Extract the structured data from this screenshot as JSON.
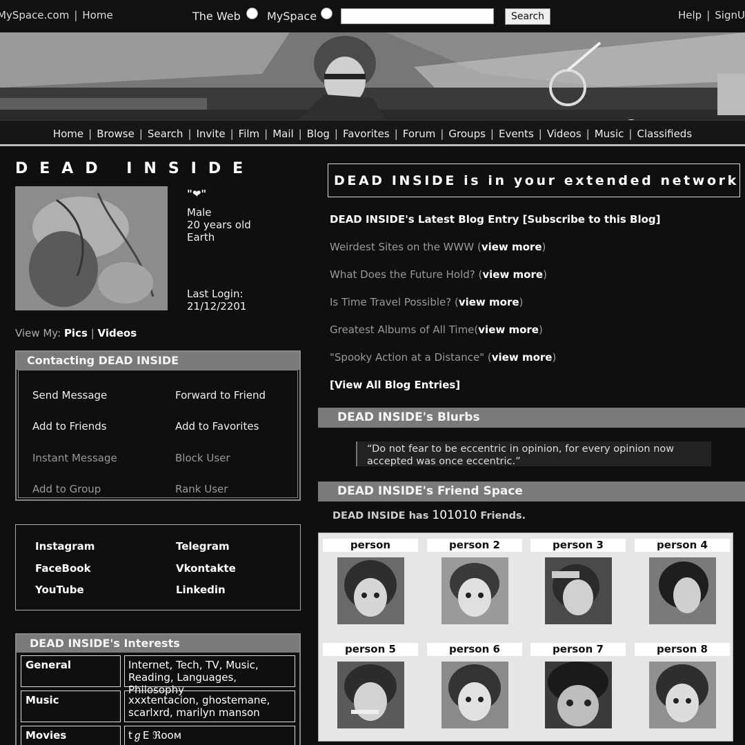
{
  "topbar": {
    "site": "MySpace.com",
    "home": "Home",
    "radio_web": "The Web",
    "radio_myspace": "MySpace",
    "search_button": "Search",
    "help": "Help",
    "signup": "SignUp"
  },
  "nav": [
    "Home",
    "Browse",
    "Search",
    "Invite",
    "Film",
    "Mail",
    "Blog",
    "Favorites",
    "Forum",
    "Groups",
    "Events",
    "Videos",
    "Music",
    "Classifieds"
  ],
  "profile": {
    "name": "DEAD INSIDE",
    "mood": "\"❤\"",
    "gender": "Male",
    "age": "20 years old",
    "location": "Earth",
    "last_login_label": "Last Login:",
    "last_login": "21/12/2201",
    "view_my_label": "View My:",
    "pics": "Pics",
    "videos": "Videos"
  },
  "contact": {
    "title": "Contacting DEAD INSIDE",
    "items": [
      "Send Message",
      "Forward to Friend",
      "Add to Friends",
      "Add to Favorites",
      "Instant Message",
      "Block User",
      "Add to Group",
      "Rank User"
    ]
  },
  "social": [
    "Instagram",
    "Telegram",
    "FaceBook",
    "Vkontakte",
    "YouTube",
    "Linkedin"
  ],
  "interests": {
    "title": "DEAD INSIDE's Interests",
    "rows": [
      {
        "key": "General",
        "value": "Internet, Tech, TV, Music, Reading, Languages, Philosophy"
      },
      {
        "key": "Music",
        "value": "xxxtentacion, ghostemane, scarlxrd, marilyn manson"
      },
      {
        "key": "Movies",
        "value": "tℊE ℜooᴍ"
      }
    ]
  },
  "network": "DEAD INSIDE is in your extended network",
  "blog": {
    "latest": "DEAD INSIDE's Latest Blog Entry",
    "subscribe": "Subscribe to this Blog",
    "view_more": "view more",
    "entries": [
      "Weirdest Sites on the WWW",
      "What Does the Future Hold?",
      "Is Time Travel Possible?",
      "Greatest Albums of All Time",
      "\"Spooky Action at a Distance\""
    ],
    "view_all": "View All Blog Entries"
  },
  "blurbs": {
    "title": "DEAD INSIDE's Blurbs",
    "quote": "“Do not fear to be eccentric in opinion, for every opinion now accepted was once eccentric.”"
  },
  "friends": {
    "title": "DEAD INSIDE's Friend Space",
    "count_prefix": "DEAD INSIDE has",
    "count": "101010",
    "count_suffix": "Friends.",
    "list": [
      "person",
      "person 2",
      "person 3",
      "person 4",
      "person 5",
      "person 6",
      "person 7",
      "person 8"
    ]
  }
}
